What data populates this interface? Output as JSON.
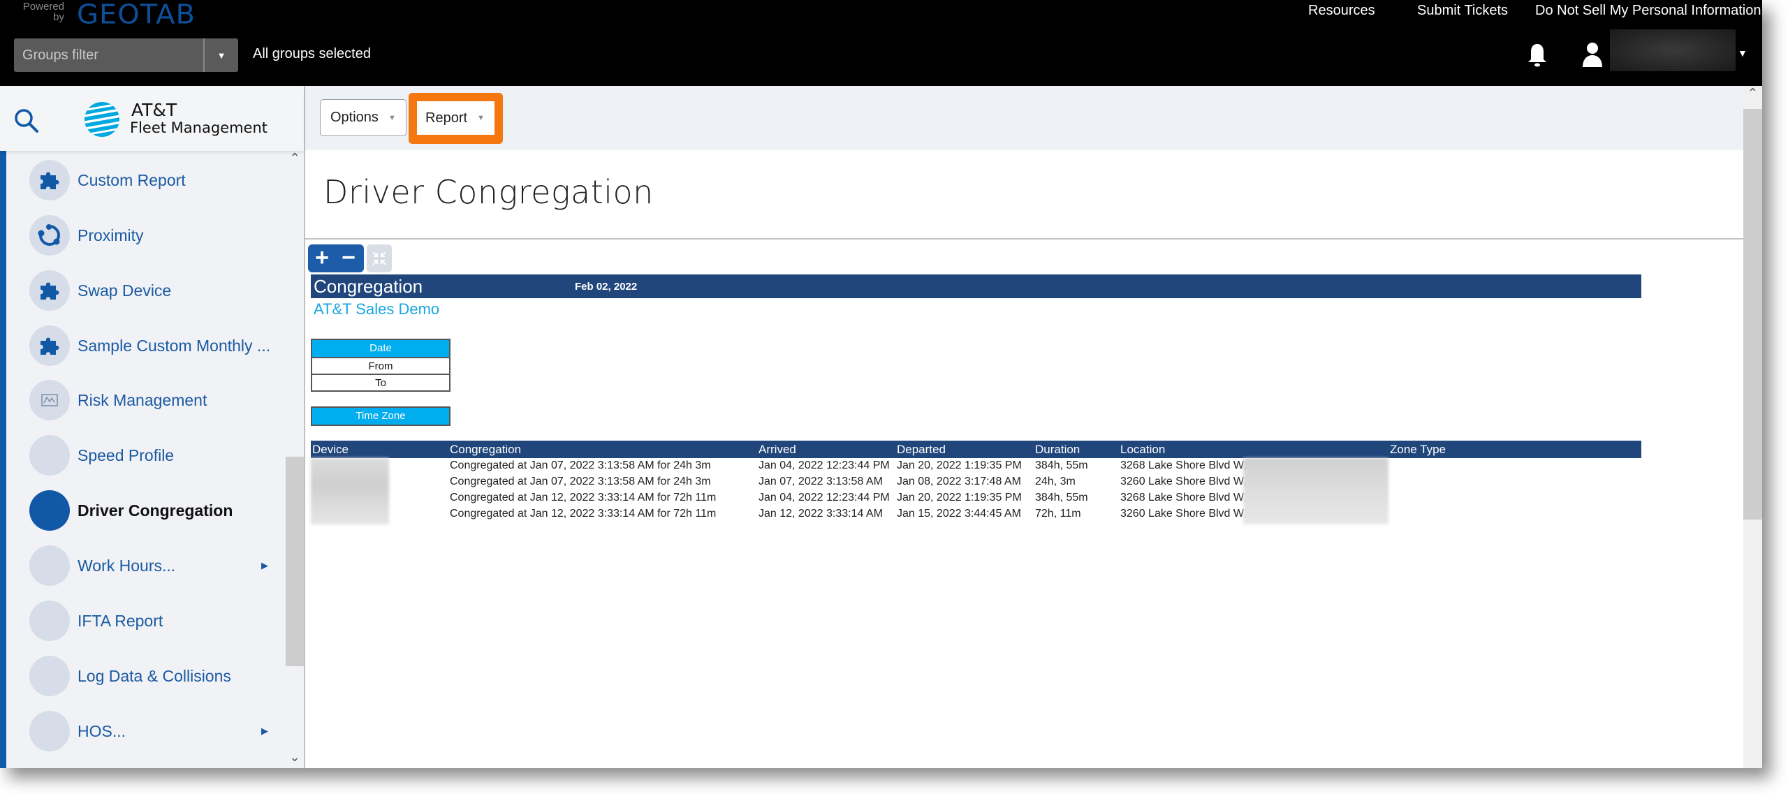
{
  "header": {
    "powered_by": "Powered by",
    "brand": "GEOTAB",
    "links": [
      "Resources",
      "Submit Tickets",
      "Do Not Sell My Personal Information"
    ],
    "groups_filter_placeholder": "Groups filter",
    "groups_status": "All groups selected",
    "icons": {
      "notifications": "bell-icon",
      "user": "user-icon",
      "user_menu": "caret-down-icon"
    }
  },
  "sidebar": {
    "search_icon": "search-icon",
    "logo_title": "AT&T",
    "logo_subtitle": "Fleet Management",
    "items": [
      {
        "label": "Custom Report",
        "icon": "puzzle-icon",
        "active": false,
        "submenu": false
      },
      {
        "label": "Proximity",
        "icon": "proximity-icon",
        "active": false,
        "submenu": false
      },
      {
        "label": "Swap Device",
        "icon": "puzzle-icon",
        "active": false,
        "submenu": false
      },
      {
        "label": "Sample Custom Monthly ...",
        "icon": "puzzle-icon",
        "active": false,
        "submenu": false
      },
      {
        "label": "Risk Management",
        "icon": "chart-icon",
        "active": false,
        "submenu": false
      },
      {
        "label": "Speed Profile",
        "icon": "blank-icon",
        "active": false,
        "submenu": false
      },
      {
        "label": "Driver Congregation",
        "icon": "blank-icon",
        "active": true,
        "submenu": false
      },
      {
        "label": "Work Hours...",
        "icon": "blank-icon",
        "active": false,
        "submenu": true
      },
      {
        "label": "IFTA Report",
        "icon": "blank-icon",
        "active": false,
        "submenu": false
      },
      {
        "label": "Log Data & Collisions",
        "icon": "blank-icon",
        "active": false,
        "submenu": false
      },
      {
        "label": "HOS...",
        "icon": "blank-icon",
        "active": false,
        "submenu": true
      }
    ]
  },
  "toolbar": {
    "options_label": "Options",
    "report_label": "Report",
    "highlight_color": "#f4780f"
  },
  "page": {
    "title": "Driver Congregation"
  },
  "report": {
    "title": "Congregation",
    "date": "Feb 02, 2022",
    "organization": "AT&T Sales Demo",
    "date_param": {
      "header": "Date",
      "rows": [
        "From",
        "To"
      ]
    },
    "timezone_param": {
      "header": "Time Zone"
    },
    "columns": [
      "Device",
      "Congregation",
      "Arrived",
      "Departed",
      "Duration",
      "Location",
      "Zone Type"
    ],
    "rows": [
      {
        "device": "",
        "congregation": "Congregated at Jan 07, 2022 3:13:58 AM for 24h 3m",
        "arrived": "Jan 04, 2022 12:23:44 PM",
        "departed": "Jan 20, 2022 1:19:35 PM",
        "duration": "384h, 55m",
        "location": "3268 Lake Shore Blvd W,",
        "zone_type": ""
      },
      {
        "device": "",
        "congregation": "Congregated at Jan 07, 2022 3:13:58 AM for 24h 3m",
        "arrived": "Jan 07, 2022 3:13:58 AM",
        "departed": "Jan 08, 2022 3:17:48 AM",
        "duration": "24h, 3m",
        "location": "3260 Lake Shore Blvd W,",
        "zone_type": ""
      },
      {
        "device": "",
        "congregation": "Congregated at Jan 12, 2022 3:33:14 AM for 72h 11m",
        "arrived": "Jan 04, 2022 12:23:44 PM",
        "departed": "Jan 20, 2022 1:19:35 PM",
        "duration": "384h, 55m",
        "location": "3268 Lake Shore Blvd W,",
        "zone_type": ""
      },
      {
        "device": "",
        "congregation": "Congregated at Jan 12, 2022 3:33:14 AM for 72h 11m",
        "arrived": "Jan 12, 2022 3:33:14 AM",
        "departed": "Jan 15, 2022 3:44:45 AM",
        "duration": "72h, 11m",
        "location": "3260 Lake Shore Blvd W,",
        "zone_type": ""
      }
    ]
  },
  "colors": {
    "header_bg": "#000000",
    "brand_blue": "#0e4f9a",
    "nav_text": "#1b5aa2",
    "active_circle": "#1158a6",
    "report_bar": "#21467b",
    "param_header": "#00aef0",
    "org_text": "#1aa6e4"
  }
}
